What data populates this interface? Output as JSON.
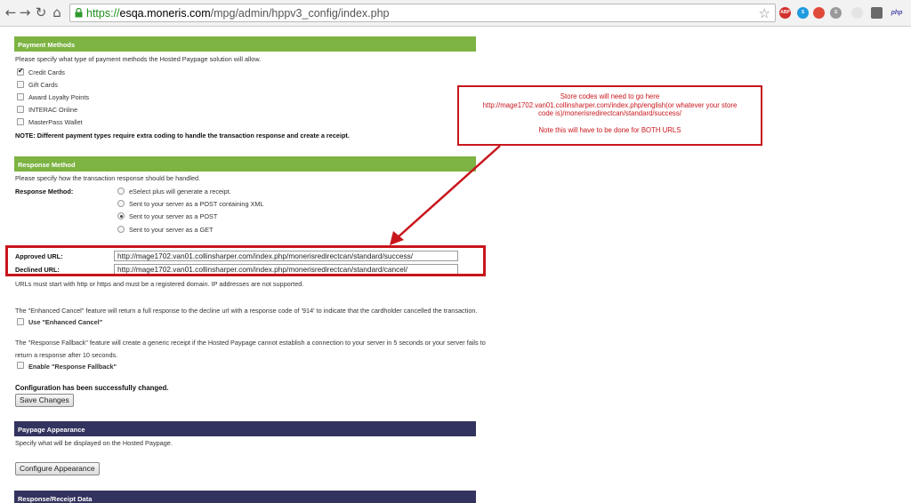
{
  "browser": {
    "url_scheme": "https://",
    "url_host": "esqa.moneris.com",
    "url_path": "/mpg/admin/hppv3_config/index.php",
    "ext_labels": [
      "ABP",
      "S",
      "",
      "S",
      "",
      "",
      "php"
    ]
  },
  "payment_methods": {
    "header": "Payment Methods",
    "intro": "Please specify what type of payment methods the Hosted Paypage solution will allow.",
    "options": [
      {
        "label": "Credit Cards",
        "checked": true
      },
      {
        "label": "Gift Cards",
        "checked": false
      },
      {
        "label": "Award Loyalty Points",
        "checked": false
      },
      {
        "label": "INTERAC Online",
        "checked": false
      },
      {
        "label": "MasterPass Wallet",
        "checked": false
      }
    ],
    "note": "NOTE: Different payment types require extra coding to handle the transaction response and create a receipt."
  },
  "response_method": {
    "header": "Response Method",
    "intro": "Please specify how the transaction response should be handled.",
    "label": "Response Method:",
    "options": [
      {
        "label": "eSelect plus will generate a receipt.",
        "checked": false
      },
      {
        "label": "Sent to your server as a POST containing XML",
        "checked": false
      },
      {
        "label": "Sent to your server as a POST",
        "checked": true
      },
      {
        "label": "Sent to your server as a GET",
        "checked": false
      }
    ]
  },
  "urls": {
    "approved_label": "Approved URL:",
    "approved_value": "http://mage1702.van01.collinsharper.com/index.php/monerisredirectcan/standard/success/",
    "declined_label": "Declined URL:",
    "declined_value": "http://mage1702.van01.collinsharper.com/index.php/monerisredirectcan/standard/cancel/",
    "note": "URLs must start with http or https and must be a registered domain. IP addresses are not supported."
  },
  "enhanced_cancel": {
    "text": "The \"Enhanced Cancel\" feature will return a full response to the decline url with a response code of '914' to indicate that the cardholder cancelled the transaction.",
    "checkbox_label": "Use \"Enhanced Cancel\""
  },
  "response_fallback": {
    "text_line1": "The \"Response Fallback\" feature will create a generic receipt if the Hosted Paypage cannot establish a connection to your server in 5 seconds or your server fails to",
    "text_line2": "return a response after 10 seconds.",
    "checkbox_label": "Enable \"Response Fallback\""
  },
  "status_message": "Configuration has been successfully changed.",
  "save_button": "Save Changes",
  "paypage_appearance": {
    "header": "Paypage Appearance",
    "intro": "Specify what will be displayed on the Hosted Paypage.",
    "button": "Configure Appearance"
  },
  "receipt_data": {
    "header": "Response/Receipt Data"
  },
  "callout": {
    "line1": "Store codes will need to go here",
    "line2": "http://mage1702.van01.collinsharper.com/index.php/english(or whatever your store",
    "line3": "code is)/monerisredirectcan/standard/success/",
    "line4": "Note this will have to be done for BOTH URLS"
  },
  "colors": {
    "section_green": "#7cb342",
    "section_navy": "#33335f",
    "annotation_red": "#c8161d"
  }
}
